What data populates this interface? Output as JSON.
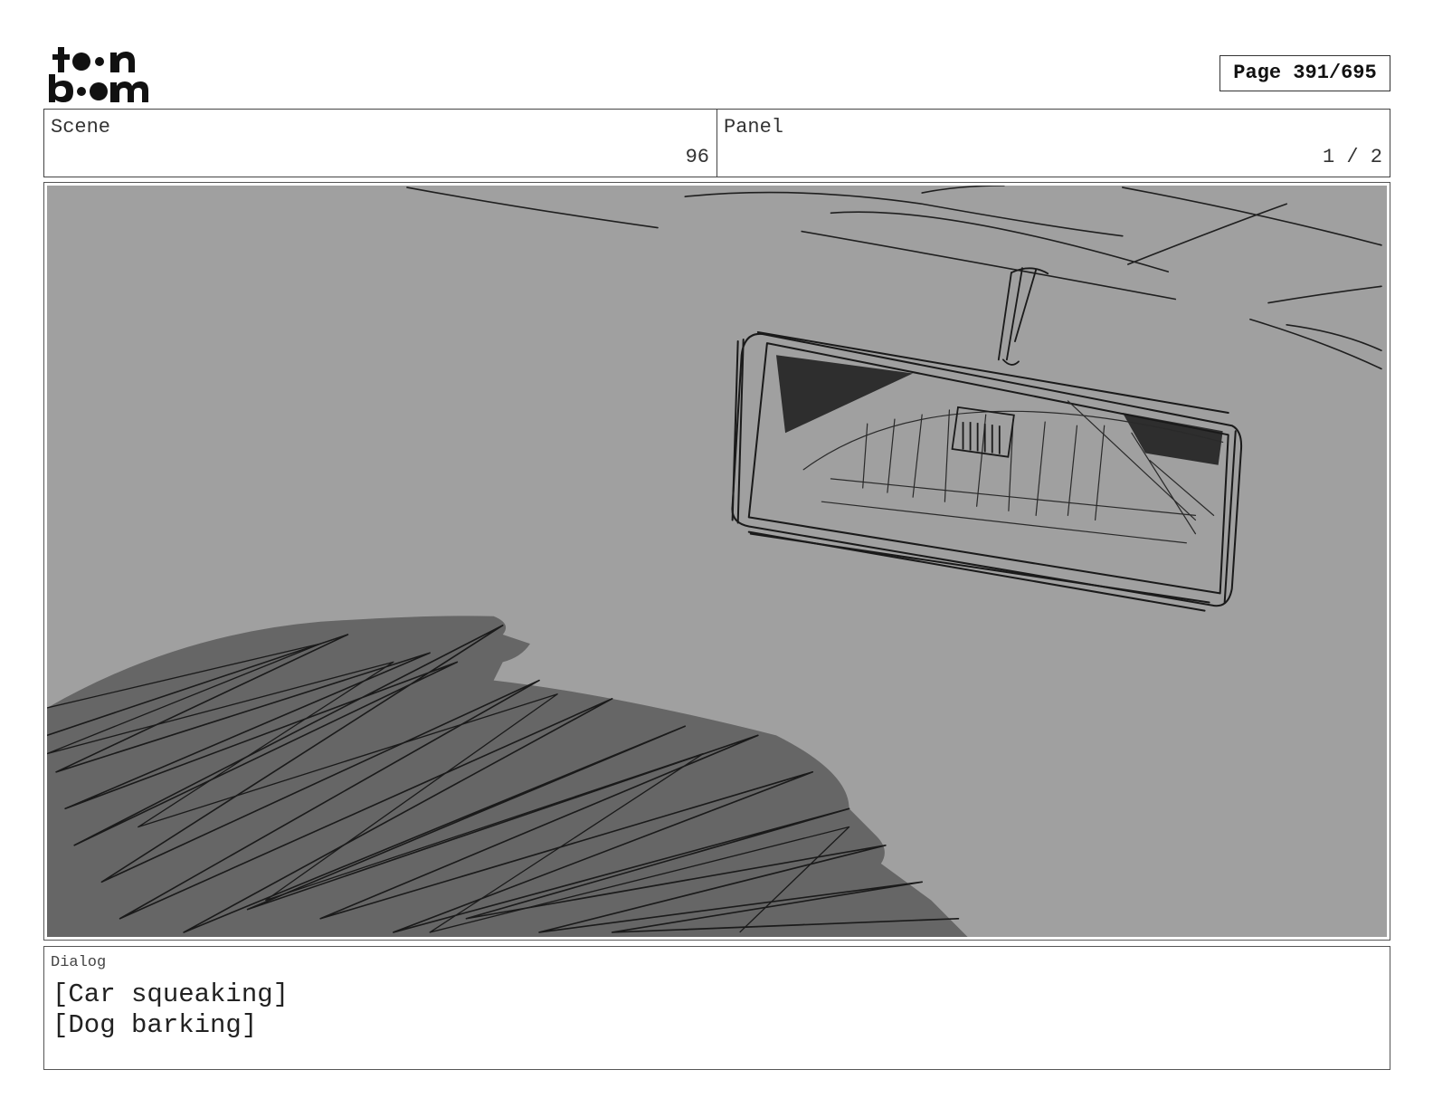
{
  "header": {
    "logo_text": "toon boom",
    "page_label": "Page 391/695"
  },
  "info": {
    "scene_label": "Scene",
    "scene_value": "96",
    "panel_label": "Panel",
    "panel_value": "1 / 2"
  },
  "panel_image": {
    "description_icon": "storyboard-sketch-rearview-mirror"
  },
  "dialog": {
    "label": "Dialog",
    "lines": [
      "[Car squeaking]",
      "[Dog barking]"
    ]
  },
  "colors": {
    "sketch_background": "#a0a0a0",
    "sketch_shadow": "#666666",
    "line": "#1a1a1a"
  }
}
